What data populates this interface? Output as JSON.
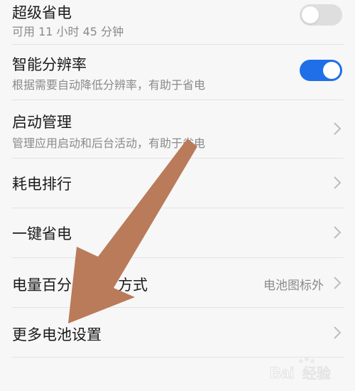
{
  "settings": {
    "super_saver": {
      "title": "超级省电",
      "subtitle": "可用 11 小时 45 分钟",
      "enabled": false
    },
    "smart_resolution": {
      "title": "智能分辨率",
      "subtitle": "根据需要自动降低分辨率，有助于省电",
      "enabled": true
    },
    "startup_manager": {
      "title": "启动管理",
      "subtitle": "管理应用启动和后台活动，有助于省电"
    },
    "power_ranking": {
      "title": "耗电排行"
    },
    "one_tap_saver": {
      "title": "一键省电"
    },
    "battery_percentage": {
      "title_visible": "电量百分",
      "title_rest": "方式",
      "value": "电池图标外"
    },
    "more_battery_settings": {
      "title": "更多电池设置"
    }
  },
  "annotation": {
    "arrow_color": "#b97b5a",
    "icon": "arrow-icon"
  },
  "colors": {
    "toggle_on": "#1f6fe8",
    "toggle_off": "#dedede",
    "text_primary": "#1a1a1a",
    "text_secondary": "#8a8a8a"
  },
  "watermark": {
    "text": "Bai经验"
  }
}
